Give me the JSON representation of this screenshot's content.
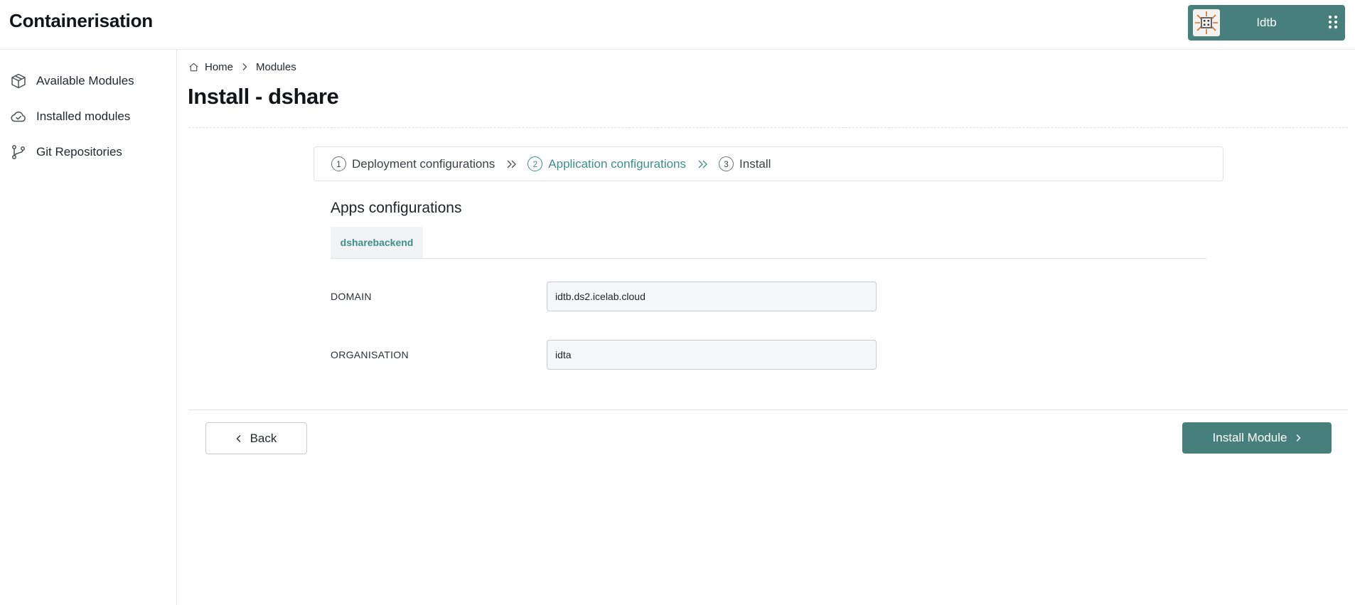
{
  "app": {
    "title": "Containerisation"
  },
  "user": {
    "name": "Idtb",
    "avatar_icon": "org-avatar-icon",
    "menu_icon": "grid-dots-icon"
  },
  "sidebar": {
    "items": [
      {
        "label": "Available Modules",
        "icon": "package-icon"
      },
      {
        "label": "Installed modules",
        "icon": "cloud-check-icon"
      },
      {
        "label": "Git Repositories",
        "icon": "git-branch-icon"
      }
    ]
  },
  "breadcrumb": {
    "home": "Home",
    "current": "Modules"
  },
  "page": {
    "title": "Install - dshare"
  },
  "stepper": {
    "steps": [
      {
        "num": "1",
        "label": "Deployment configurations",
        "state": "done"
      },
      {
        "num": "2",
        "label": "Application configurations",
        "state": "active"
      },
      {
        "num": "3",
        "label": "Install",
        "state": "pending"
      }
    ]
  },
  "apps": {
    "title": "Apps configurations",
    "tabs": [
      {
        "label": "dsharebackend",
        "selected": true
      }
    ],
    "fields": [
      {
        "label": "DOMAIN",
        "value": "idtb.ds2.icelab.cloud"
      },
      {
        "label": "ORGANISATION",
        "value": "idta"
      }
    ]
  },
  "actions": {
    "back_label": "Back",
    "install_label": "Install Module"
  },
  "colors": {
    "accent": "#467f7c",
    "active_step": "#3f8f89",
    "border": "#dfe2e6"
  }
}
